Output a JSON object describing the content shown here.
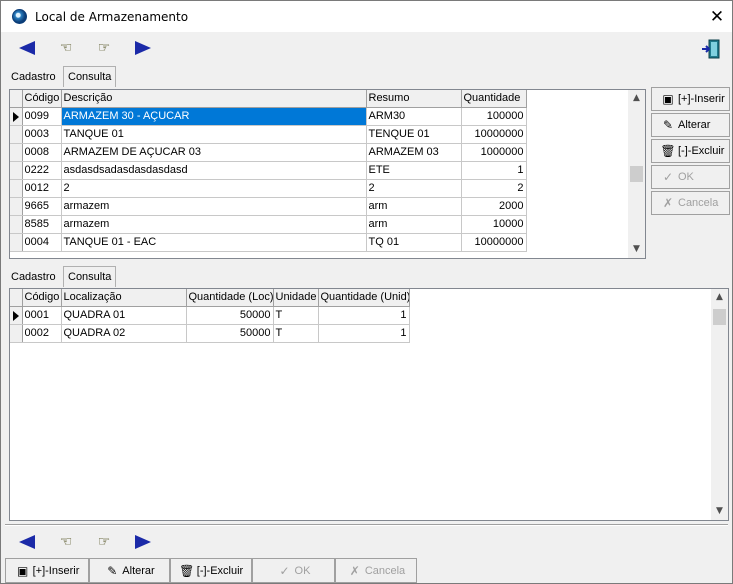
{
  "window": {
    "title": "Local de Armazenamento",
    "close_glyph": "✕"
  },
  "nav": {
    "first": "arrow-left-icon",
    "prev": "hand-left-icon",
    "next": "hand-right-icon",
    "last": "arrow-right-icon",
    "exit": "exit-door-icon"
  },
  "top_tabs": [
    "Cadastro",
    "Consulta"
  ],
  "top_grid": {
    "columns": [
      "Código",
      "Descrição",
      "Resumo",
      "Quantidade"
    ],
    "rows": [
      [
        "0099",
        "ARMAZEM 30 - AÇUCAR",
        "ARM30",
        "100000"
      ],
      [
        "0003",
        "TANQUE 01",
        "TENQUE 01",
        "10000000"
      ],
      [
        "0008",
        "ARMAZEM DE AÇUCAR 03",
        "ARMAZEM 03",
        "1000000"
      ],
      [
        "0222",
        "asdasdsadasdasdasdasd",
        "ETE",
        "1"
      ],
      [
        "0012",
        "2",
        "2",
        "2"
      ],
      [
        "9665",
        "armazem",
        "arm",
        "2000"
      ],
      [
        "8585",
        "armazem",
        "arm",
        "10000"
      ],
      [
        "0004",
        "TANQUE 01 - EAC",
        "TQ 01",
        "10000000"
      ]
    ],
    "selected_row": 0
  },
  "side_buttons": {
    "insert": "[+]-Inserir",
    "alter": "Alterar",
    "delete": "[-]-Excluir",
    "ok": "OK",
    "cancel": "Cancela"
  },
  "bottom_tabs": [
    "Cadastro",
    "Consulta"
  ],
  "bottom_grid": {
    "columns": [
      "Código",
      "Localização",
      "Quantidade (Loc)",
      "Unidade",
      "Quantidade (Unid)"
    ],
    "rows": [
      [
        "0001",
        "QUADRA 01",
        "50000",
        "T",
        "1"
      ],
      [
        "0002",
        "QUADRA 02",
        "50000",
        "T",
        "1"
      ]
    ],
    "selected_row": 0
  },
  "bottom_buttons": {
    "insert": "[+]-Inserir",
    "alter": "Alterar",
    "delete": "[-]-Excluir",
    "ok": "OK",
    "cancel": "Cancela"
  },
  "colors": {
    "selection": "#0078d7",
    "nav_arrow": "#1b2aa8"
  }
}
